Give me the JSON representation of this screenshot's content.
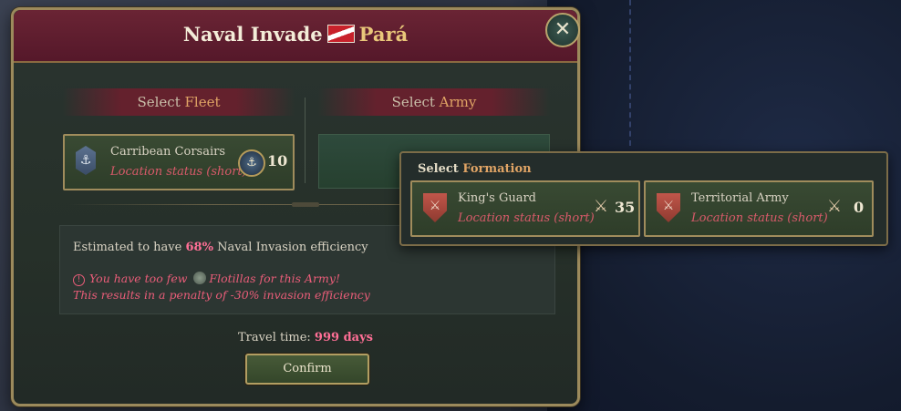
{
  "dialog": {
    "title_prefix": "Naval Invade",
    "province": "Pará",
    "close_label": "✕"
  },
  "sections": {
    "fleet": {
      "prefix": "Select",
      "highlight": "Fleet"
    },
    "army": {
      "prefix": "Select",
      "highlight": "Army"
    }
  },
  "fleet": {
    "name": "Carribean Corsairs",
    "status": "Location status (short)",
    "count": "10",
    "emblem_icon": "anchor-icon",
    "ship_icon": "ship-icon"
  },
  "info": {
    "estimate_prefix": "Estimated to have",
    "efficiency": "68%",
    "estimate_suffix": "Naval Invasion efficiency",
    "warning_prefix": "You have too few",
    "warning_suffix": "Flotillas for this Army!",
    "penalty": "This results in a penalty of -30% invasion efficiency"
  },
  "travel": {
    "label": "Travel time:",
    "value": "999 days"
  },
  "confirm_label": "Confirm",
  "formation_panel": {
    "prefix": "Select",
    "highlight": "Formation",
    "items": [
      {
        "name": "King's Guard",
        "status": "Location status (short)",
        "count": "35"
      },
      {
        "name": "Territorial Army",
        "status": "Location status (short)",
        "count": "0"
      }
    ]
  },
  "colors": {
    "accent_pink": "#ff6f96",
    "status_red": "#d85a6a",
    "header_maroon": "#6a2434",
    "border_gold": "#a08c5c",
    "highlight_orange": "#e0a465"
  }
}
